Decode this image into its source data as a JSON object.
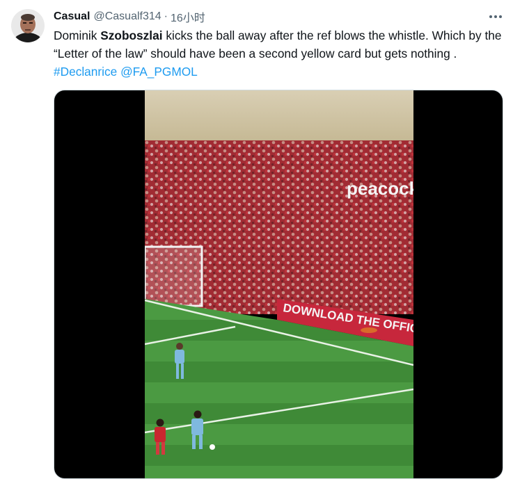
{
  "tweet": {
    "display_name": "Casual",
    "handle": "@Casualf314",
    "separator": "·",
    "time": "16小时",
    "text": {
      "part1": "Dominik ",
      "bold": "Szoboszlai",
      "part2": " kicks the ball away after the ref blows the whistle. Which by the “Letter of the law” should have been a second yellow card but gets nothing . ",
      "hashtag": "#Declanrice",
      "space": " ",
      "mention": "@FA_PGMOL"
    }
  },
  "media": {
    "board_text_1": "peacock",
    "board_text_2": "DOWNLOAD THE OFFICIAL"
  },
  "colors": {
    "link": "#1d9bf0",
    "secondary_text": "#536471",
    "pitch": "#3f8f3a",
    "crowd": "#b8323a"
  },
  "icons": {
    "more": "more-icon",
    "avatar": "avatar"
  }
}
